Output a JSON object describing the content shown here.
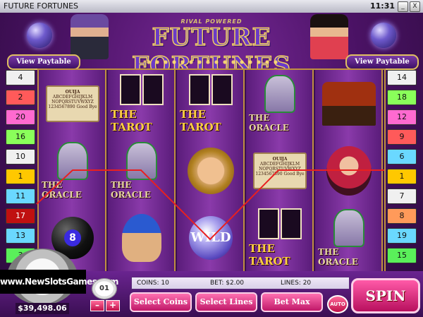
{
  "window": {
    "title": "FUTURE FORTUNES",
    "clock": "11:31",
    "minimize": "_",
    "close": "X"
  },
  "logo": {
    "maker": "RIVAL POWERED",
    "title": "FUTURE FORTUNES"
  },
  "paytable": {
    "left_label": "View Paytable",
    "right_label": "View Paytable"
  },
  "lines_left": [
    {
      "num": "4",
      "color": "#f0f0f0"
    },
    {
      "num": "2",
      "color": "#ff5a5a"
    },
    {
      "num": "20",
      "color": "#ff6ad0"
    },
    {
      "num": "16",
      "color": "#8aff5a"
    },
    {
      "num": "10",
      "color": "#f0f0f0"
    },
    {
      "num": "1",
      "color": "#ffc800"
    },
    {
      "num": "11",
      "color": "#6ad8ff"
    },
    {
      "num": "17",
      "color": "#c01010",
      "active": true
    },
    {
      "num": "13",
      "color": "#6ad8ff"
    },
    {
      "num": "3",
      "color": "#5af05a"
    }
  ],
  "lines_right": [
    {
      "num": "14",
      "color": "#f0f0f0"
    },
    {
      "num": "18",
      "color": "#8aff5a"
    },
    {
      "num": "12",
      "color": "#ff6ad0"
    },
    {
      "num": "9",
      "color": "#ff5a5a"
    },
    {
      "num": "6",
      "color": "#6ad8ff"
    },
    {
      "num": "1",
      "color": "#ffc800"
    },
    {
      "num": "7",
      "color": "#f0f0f0"
    },
    {
      "num": "8",
      "color": "#ff9a5a"
    },
    {
      "num": "19",
      "color": "#6ad8ff"
    },
    {
      "num": "15",
      "color": "#5af05a"
    }
  ],
  "reels": [
    [
      "ouija",
      "oracle",
      "eightball"
    ],
    [
      "tarot",
      "oracle",
      "turban"
    ],
    [
      "tarot",
      "palm",
      "wild"
    ],
    [
      "oracle",
      "ouija",
      "tarot"
    ],
    [
      "wagon",
      "gypsy",
      "oracle"
    ]
  ],
  "symbol_labels": {
    "tarot": "THE TAROT",
    "oracle": "THE ORACLE",
    "wild": "WILD",
    "ouija": "OUIJA",
    "ouija_text": "ABCDEFGHIJKLM NOPQRSTUVWXYZ 1234567890 Good Bye",
    "eightball": "8"
  },
  "winline_color": "#e82020",
  "balance": "$39,498.06",
  "watermark": "www.NewSlotsGames.com",
  "denomination": "01",
  "denom_buttons": {
    "minus": "–",
    "plus": "+"
  },
  "info": {
    "coins": "COINS: 10",
    "bet": "BET: $2.00",
    "lines": "LINES: 20"
  },
  "buttons": {
    "select_coins": "Select Coins",
    "select_lines": "Select Lines",
    "bet_max": "Bet Max",
    "auto": "AUTO",
    "spin": "SPIN"
  }
}
